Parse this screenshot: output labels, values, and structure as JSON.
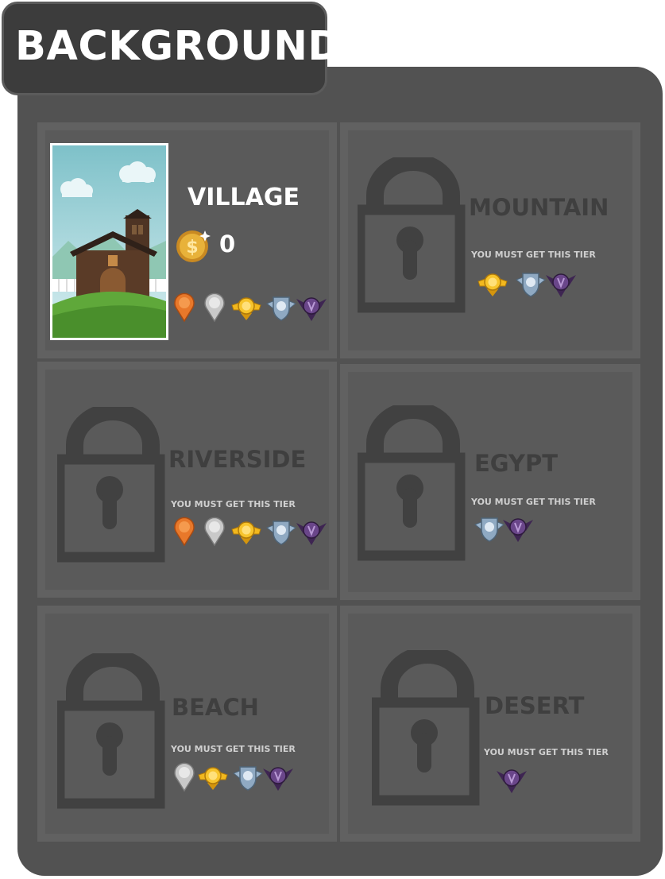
{
  "header": {
    "title": "BACKGROUND"
  },
  "levels": [
    {
      "name": "VILLAGE",
      "coins": "0",
      "locked": false
    },
    {
      "name": "MOUNTAIN",
      "tier_note": "YOU MUST GET THIS TIER",
      "locked": true
    },
    {
      "name": "RIVERSIDE",
      "tier_note": "YOU MUST GET THIS TIER",
      "locked": true
    },
    {
      "name": "EGYPT",
      "tier_note": "YOU MUST GET THIS TIER",
      "locked": true
    },
    {
      "name": "BEACH",
      "tier_note": "YOU MUST GET THIS TIER",
      "locked": true
    },
    {
      "name": "DESERT",
      "tier_note": "YOU MUST GET THIS TIER",
      "locked": true
    }
  ],
  "tier_badges": {
    "village": [
      "bronze-tier-badge",
      "silver-tier-badge",
      "gold-tier-badge",
      "platinum-tier-badge",
      "purple-tier-badge"
    ],
    "mountain": [
      "gold-tier-badge",
      "platinum-tier-badge",
      "purple-tier-badge"
    ],
    "riverside": [
      "bronze-tier-badge",
      "silver-tier-badge",
      "gold-tier-badge",
      "platinum-tier-badge",
      "purple-tier-badge"
    ],
    "egypt": [
      "platinum-tier-badge",
      "purple-tier-badge"
    ],
    "beach": [
      "silver-tier-badge",
      "gold-tier-badge",
      "platinum-tier-badge",
      "purple-tier-badge"
    ],
    "desert": [
      "purple-tier-badge"
    ]
  },
  "colors": {
    "panel": "#525252",
    "cell": "#5a5a5a",
    "locked_text": "#3f3f3f",
    "coin": "#e0a93a",
    "bronze": "#e8782a",
    "silver": "#c9c9c9",
    "gold": "#f2b81e",
    "platinum": "#9bb4cc",
    "purple": "#5e3d78"
  }
}
